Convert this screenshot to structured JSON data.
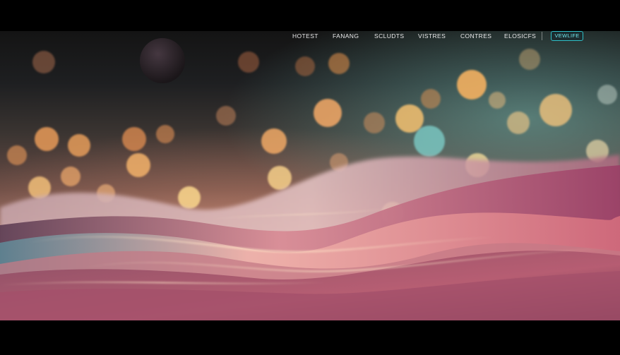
{
  "nav": {
    "links": [
      {
        "label": "HOTEST"
      },
      {
        "label": "FANANG"
      },
      {
        "label": "SCLUDTS"
      },
      {
        "label": "VISTRES"
      },
      {
        "label": "CONTRES"
      },
      {
        "label": "ELOSICFS"
      }
    ],
    "cta_label": "VEWLIFE"
  },
  "colors": {
    "accent": "#2fc0c8",
    "nav_text": "#e9e9ea",
    "letterbox": "#000000"
  }
}
